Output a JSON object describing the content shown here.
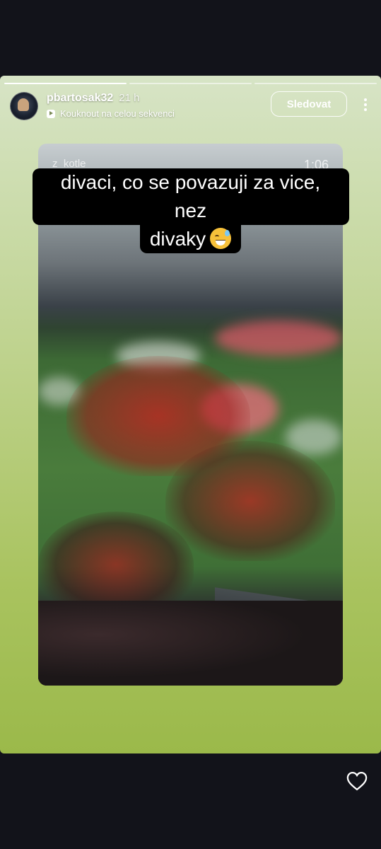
{
  "story": {
    "username": "pbartosak32",
    "time_ago": "21 h",
    "sequence_link": "Kouknout na celou sekvenci",
    "follow_label": "Sledovat",
    "more_icon": "more-vertical-icon",
    "progress_segments": 3,
    "active_segment": 1
  },
  "video": {
    "watermark": "z_kotle",
    "duration": "1:06"
  },
  "caption": {
    "line1": "divaci, co se povazuji za vice, nez",
    "line2": "divaky",
    "emoji": "grinning-face-with-sweat"
  },
  "footer": {
    "like_icon": "heart-outline-icon"
  },
  "colors": {
    "background": "#12131a",
    "story_gradient_top": "#d7e4c6",
    "story_gradient_bottom": "#9bb94a",
    "caption_bg": "#000000"
  }
}
